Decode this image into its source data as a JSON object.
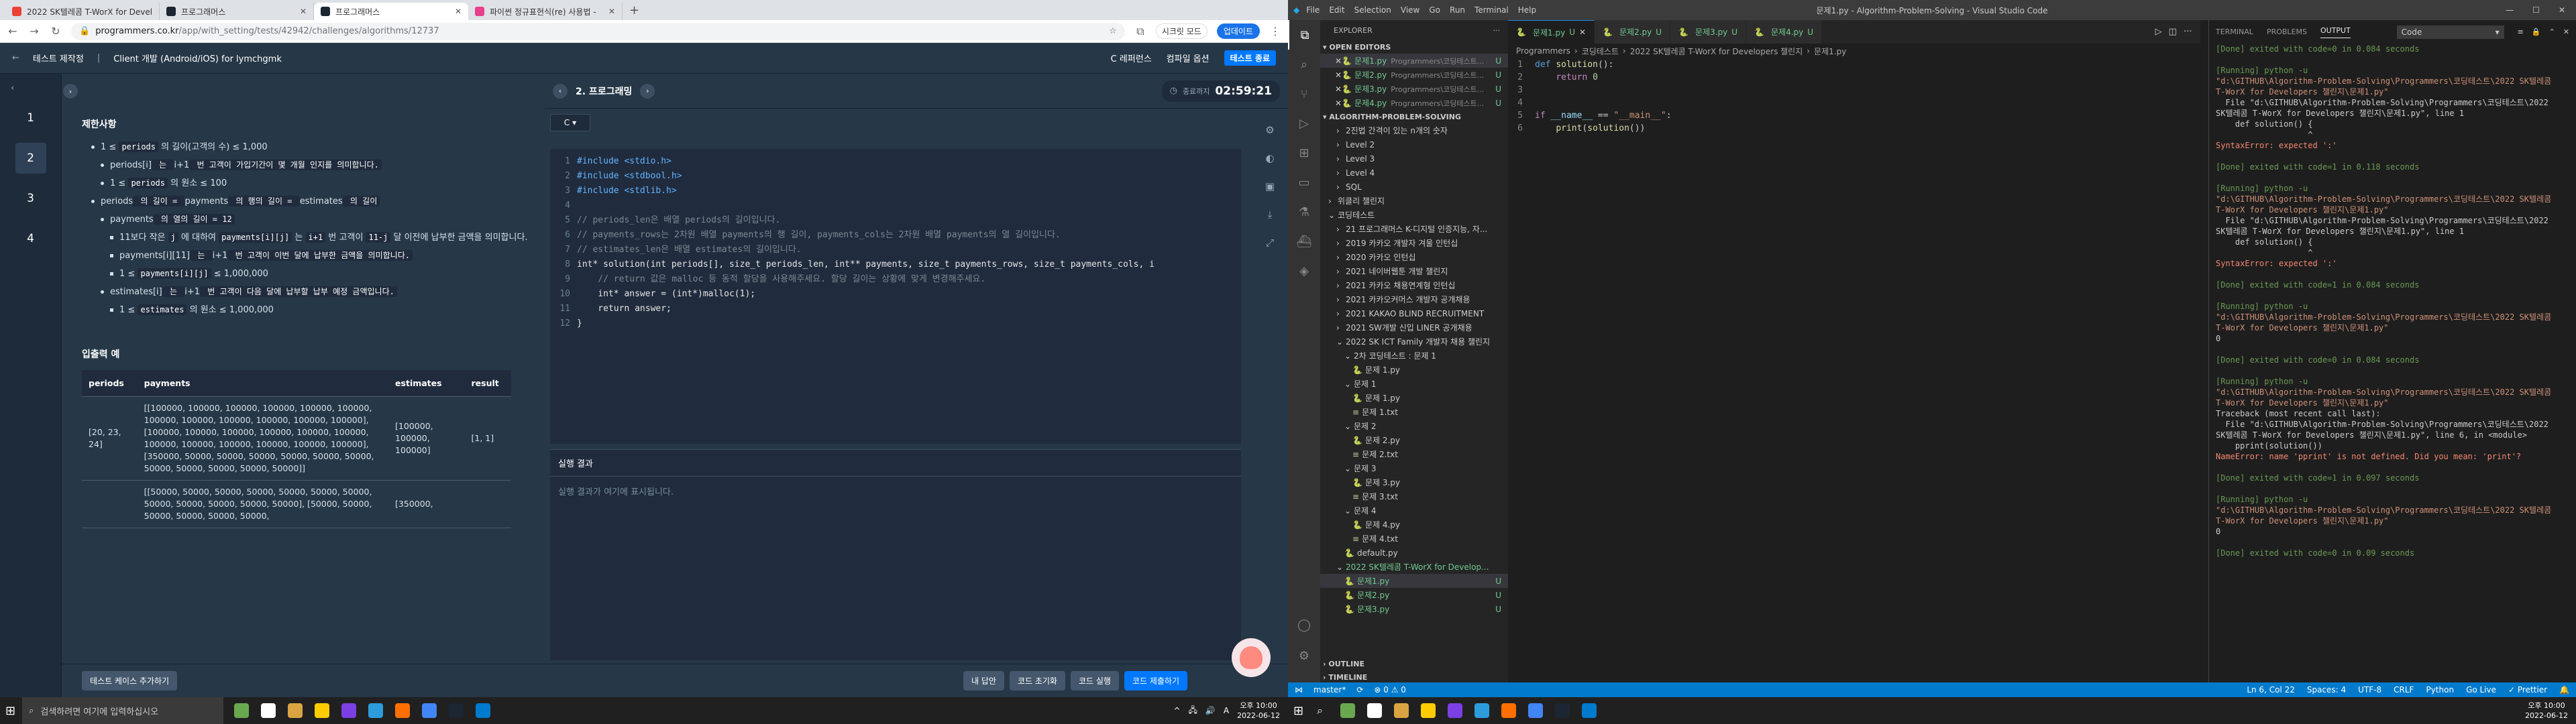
{
  "chrome": {
    "tabs": [
      {
        "label": "2022 SK텔레콤 T-WorX for Devel",
        "color": "#ea4335"
      },
      {
        "label": "프로그래머스",
        "color": "#1c2633"
      },
      {
        "label": "프로그래머스",
        "color": "#1c2633"
      },
      {
        "label": "파이썬 정규표현식(re) 사용법 -",
        "color": "#e83e8c"
      }
    ],
    "url_host": "programmers.co.kr",
    "url_path": "/app/with_setting/tests/42942/challenges/algorithms/12737",
    "secret_mode": "시크릿 모드",
    "update_label": "업데이트"
  },
  "pg": {
    "breadcrumb_test": "테스트 제작정",
    "breadcrumb_course": "Client 개발 (Android/iOS) for lymchgmk",
    "header_links": [
      "C 레퍼런스",
      "컴파일 옵션"
    ],
    "test_end": "테스트 종료",
    "questions": [
      "1",
      "2",
      "3",
      "4"
    ],
    "problem_title": "2. 프로그래밍",
    "timer_label": "종료까지",
    "timer_value": "02:59:21",
    "lang": "C",
    "section_constraints": "제한사항",
    "constraints": [
      {
        "level": 1,
        "parts": [
          "1 ≤ ",
          "periods",
          " 의 길이(고객의 수) ≤ 1,000"
        ]
      },
      {
        "level": 2,
        "parts": [
          "periods[i]",
          " 는 ",
          "i+1",
          " 번 고객이 가입기간이 몇 개월 인지를 의미합니다."
        ]
      },
      {
        "level": 2,
        "parts": [
          "1 ≤ ",
          "periods",
          " 의 원소 ≤ 100"
        ]
      },
      {
        "level": 1,
        "parts": [
          "periods",
          " 의 길이 = ",
          "payments",
          " 의 행의 길이 = ",
          "estimates",
          " 의 길이"
        ]
      },
      {
        "level": 2,
        "parts": [
          "payments",
          " 의 열의 길이 = 12"
        ]
      },
      {
        "level": 3,
        "parts": [
          "11보다 작은 ",
          "j",
          " 에 대하여 ",
          "payments[i][j]",
          " 는 ",
          "i+1",
          " 번 고객이 ",
          "11-j",
          " 달 이전에 납부한 금액을 의미합니다."
        ]
      },
      {
        "level": 3,
        "parts": [
          "payments[i][11]",
          " 는 ",
          "i+1",
          " 번 고객이 이번 달에 납부한 금액을 의미합니다."
        ]
      },
      {
        "level": 3,
        "parts": [
          "1 ≤ ",
          "payments[i][j]",
          " ≤ 1,000,000"
        ]
      },
      {
        "level": 2,
        "parts": [
          "estimates[i]",
          " 는 ",
          "i+1",
          " 번 고객이 다음 달에 납부할 납부 예정 금액입니다."
        ]
      },
      {
        "level": 3,
        "parts": [
          "1 ≤ ",
          "estimates",
          " 의 원소 ≤ 1,000,000"
        ]
      }
    ],
    "section_example": "입출력 예",
    "example_headers": [
      "periods",
      "payments",
      "estimates",
      "result"
    ],
    "example_rows": [
      [
        "[20, 23, 24]",
        "[[100000, 100000, 100000, 100000, 100000, 100000, 100000, 100000, 100000, 100000, 100000, 100000], [100000, 100000, 100000, 100000, 100000, 100000, 100000, 100000, 100000, 100000, 100000, 100000], [350000, 50000, 50000, 50000, 50000, 50000, 50000, 50000, 50000, 50000, 50000, 50000]]",
        "[100000, 100000, 100000]",
        "[1, 1]"
      ],
      [
        "",
        "[[50000, 50000, 50000, 50000, 50000, 50000, 50000, 50000, 50000, 50000, 50000, 50000], [50000, 50000, 50000, 50000, 50000, 50000,",
        "[350000,",
        ""
      ]
    ],
    "code_lines": [
      "#include <stdio.h>",
      "#include <stdbool.h>",
      "#include <stdlib.h>",
      "",
      "// periods_len은 배열 periods의 길이입니다.",
      "// payments_rows는 2차원 배열 payments의 행 길이, payments_cols는 2차원 배열 payments의 열 길이입니다.",
      "// estimates_len은 배열 estimates의 길이입니다.",
      "int* solution(int periods[], size_t periods_len, int** payments, size_t payments_rows, size_t payments_cols, i",
      "    // return 값은 malloc 등 동적 할당을 사용해주세요. 할당 길이는 상황에 맞게 변경해주세요.",
      "    int* answer = (int*)malloc(1);",
      "    return answer;",
      "}"
    ],
    "result_title": "실행 결과",
    "result_placeholder": "실행 결과가 여기에 표시됩니다.",
    "add_test": "테스트 케이스 추가하기",
    "btn_question": "내 답안",
    "btn_reset": "코드 초기화",
    "btn_run": "코드 실행",
    "btn_submit": "코드 제출하기"
  },
  "taskbar_left": {
    "search_placeholder": "검색하려면 여기에 입력하십시오",
    "time": "오후 10:00",
    "date": "2022-06-12",
    "icon_colors": [
      "#6aa84f",
      "#fff",
      "#d9a441",
      "#ffcc00",
      "#7b3fe4",
      "#2d9cdb",
      "#ff6f00",
      "#4285f4",
      "#1c2633",
      "#007acc"
    ]
  },
  "vscode": {
    "menu": [
      "File",
      "Edit",
      "Selection",
      "View",
      "Go",
      "Run",
      "Terminal",
      "Help"
    ],
    "window_title": "문제1.py - Algorithm-Problem-Solving - Visual Studio Code",
    "explorer_title": "EXPLORER",
    "open_editors": "OPEN EDITORS",
    "open_files": [
      {
        "name": "문제1.py",
        "path": "Programmers\\코딩테스트...",
        "status": "U"
      },
      {
        "name": "문제2.py",
        "path": "Programmers\\코딩테스트...",
        "status": "U"
      },
      {
        "name": "문제3.py",
        "path": "Programmers\\코딩테스트...",
        "status": "U"
      },
      {
        "name": "문제4.py",
        "path": "Programmers\\코딩테스트...",
        "status": "U"
      }
    ],
    "project": "ALGORITHM-PROBLEM-SOLVING",
    "tree": [
      {
        "indent": 1,
        "label": "2진법 간격이 있는 n개의 숫자",
        "kind": "folder"
      },
      {
        "indent": 1,
        "label": "Level 2",
        "kind": "folder"
      },
      {
        "indent": 1,
        "label": "Level 3",
        "kind": "folder"
      },
      {
        "indent": 1,
        "label": "Level 4",
        "kind": "folder"
      },
      {
        "indent": 1,
        "label": "SQL",
        "kind": "folder"
      },
      {
        "indent": 0,
        "label": "위클리 챌린지",
        "kind": "folder"
      },
      {
        "indent": 0,
        "label": "코딩테스트",
        "kind": "folder-open"
      },
      {
        "indent": 1,
        "label": "21 프로그래머스 K-디지털 인증지능, 자...",
        "kind": "folder"
      },
      {
        "indent": 1,
        "label": "2019 카카오 개발자 겨울 인턴십",
        "kind": "folder"
      },
      {
        "indent": 1,
        "label": "2020 카카오 인턴십",
        "kind": "folder"
      },
      {
        "indent": 1,
        "label": "2021 네이버웹툰 개발 챌린지",
        "kind": "folder"
      },
      {
        "indent": 1,
        "label": "2021 카카오 채용연계형 인턴십",
        "kind": "folder"
      },
      {
        "indent": 1,
        "label": "2021 카카오커머스 개발자 공개채용",
        "kind": "folder"
      },
      {
        "indent": 1,
        "label": "2021 KAKAO BLIND RECRUITMENT",
        "kind": "folder"
      },
      {
        "indent": 1,
        "label": "2021 SW개발 신입 LINER 공개채용",
        "kind": "folder"
      },
      {
        "indent": 1,
        "label": "2022 SK ICT Family 개발자 채용 챌린지",
        "kind": "folder-open"
      },
      {
        "indent": 2,
        "label": "2차 코딩테스트 : 문제 1",
        "kind": "folder-open"
      },
      {
        "indent": 3,
        "label": "문제 1.py",
        "kind": "py"
      },
      {
        "indent": 2,
        "label": "문제 1",
        "kind": "folder-open"
      },
      {
        "indent": 3,
        "label": "문제 1.py",
        "kind": "py"
      },
      {
        "indent": 3,
        "label": "문제 1.txt",
        "kind": "txt"
      },
      {
        "indent": 2,
        "label": "문제 2",
        "kind": "folder-open"
      },
      {
        "indent": 3,
        "label": "문제 2.py",
        "kind": "py"
      },
      {
        "indent": 3,
        "label": "문제 2.txt",
        "kind": "txt"
      },
      {
        "indent": 2,
        "label": "문제 3",
        "kind": "folder-open"
      },
      {
        "indent": 3,
        "label": "문제 3.py",
        "kind": "py"
      },
      {
        "indent": 3,
        "label": "문제 3.txt",
        "kind": "txt"
      },
      {
        "indent": 2,
        "label": "문제 4",
        "kind": "folder-open"
      },
      {
        "indent": 3,
        "label": "문제 4.py",
        "kind": "py"
      },
      {
        "indent": 3,
        "label": "문제 4.txt",
        "kind": "txt"
      },
      {
        "indent": 2,
        "label": "default.py",
        "kind": "py"
      },
      {
        "indent": 1,
        "label": "2022 SK텔레콤 T-WorX for Develop...",
        "kind": "folder-open-green"
      },
      {
        "indent": 2,
        "label": "문제1.py",
        "kind": "py-sel",
        "status": "U"
      },
      {
        "indent": 2,
        "label": "문제2.py",
        "kind": "py-green",
        "status": "U"
      },
      {
        "indent": 2,
        "label": "문제3.py",
        "kind": "py-green",
        "status": "U"
      }
    ],
    "outline": "OUTLINE",
    "timeline": "TIMELINE",
    "editor_tabs": [
      {
        "label": "문제1.py",
        "status": "U"
      },
      {
        "label": "문제2.py",
        "status": "U"
      },
      {
        "label": "문제3.py",
        "status": "U"
      },
      {
        "label": "문제4.py",
        "status": "U"
      }
    ],
    "breadcrumbs": [
      "Programmers",
      "코딩테스트",
      "2022 SK텔레콤 T-WorX for Developers 챌린지",
      "문제1.py"
    ],
    "panel_tabs": [
      "TERMINAL",
      "PROBLEMS",
      "OUTPUT"
    ],
    "panel_select": "Code",
    "output_lines": [
      {
        "t": "done",
        "s": "[Done] exited with code=0 in 0.084 seconds"
      },
      {
        "t": "",
        "s": ""
      },
      {
        "t": "run",
        "s": "[Running] python -u"
      },
      {
        "t": "path",
        "s": "\"d:\\GITHUB\\Algorithm-Problem-Solving\\Programmers\\코딩테스트\\2022 SK텔레콤"
      },
      {
        "t": "path",
        "s": "T-WorX for Developers 챌린지\\문제1.py\""
      },
      {
        "t": "",
        "s": "  File \"d:\\GITHUB\\Algorithm-Problem-Solving\\Programmers\\코딩테스트\\2022"
      },
      {
        "t": "",
        "s": "SK텔레콤 T-WorX for Developers 챌린지\\문제1.py\", line 1"
      },
      {
        "t": "",
        "s": "    def solution() {"
      },
      {
        "t": "",
        "s": "                   ^"
      },
      {
        "t": "err",
        "s": "SyntaxError: expected ':'"
      },
      {
        "t": "",
        "s": ""
      },
      {
        "t": "done",
        "s": "[Done] exited with code=1 in 0.118 seconds"
      },
      {
        "t": "",
        "s": ""
      },
      {
        "t": "run",
        "s": "[Running] python -u"
      },
      {
        "t": "path",
        "s": "\"d:\\GITHUB\\Algorithm-Problem-Solving\\Programmers\\코딩테스트\\2022 SK텔레콤"
      },
      {
        "t": "path",
        "s": "T-WorX for Developers 챌린지\\문제1.py\""
      },
      {
        "t": "",
        "s": "  File \"d:\\GITHUB\\Algorithm-Problem-Solving\\Programmers\\코딩테스트\\2022"
      },
      {
        "t": "",
        "s": "SK텔레콤 T-WorX for Developers 챌린지\\문제1.py\", line 1"
      },
      {
        "t": "",
        "s": "    def solution() {"
      },
      {
        "t": "",
        "s": "                   ^"
      },
      {
        "t": "err",
        "s": "SyntaxError: expected ':'"
      },
      {
        "t": "",
        "s": ""
      },
      {
        "t": "done",
        "s": "[Done] exited with code=1 in 0.084 seconds"
      },
      {
        "t": "",
        "s": ""
      },
      {
        "t": "run",
        "s": "[Running] python -u"
      },
      {
        "t": "path",
        "s": "\"d:\\GITHUB\\Algorithm-Problem-Solving\\Programmers\\코딩테스트\\2022 SK텔레콤"
      },
      {
        "t": "path",
        "s": "T-WorX for Developers 챌린지\\문제1.py\""
      },
      {
        "t": "",
        "s": "0"
      },
      {
        "t": "",
        "s": ""
      },
      {
        "t": "done",
        "s": "[Done] exited with code=0 in 0.084 seconds"
      },
      {
        "t": "",
        "s": ""
      },
      {
        "t": "run",
        "s": "[Running] python -u"
      },
      {
        "t": "path",
        "s": "\"d:\\GITHUB\\Algorithm-Problem-Solving\\Programmers\\코딩테스트\\2022 SK텔레콤"
      },
      {
        "t": "path",
        "s": "T-WorX for Developers 챌린지\\문제1.py\""
      },
      {
        "t": "",
        "s": "Traceback (most recent call last):"
      },
      {
        "t": "",
        "s": "  File \"d:\\GITHUB\\Algorithm-Problem-Solving\\Programmers\\코딩테스트\\2022"
      },
      {
        "t": "",
        "s": "SK텔레콤 T-WorX for Developers 챌린지\\문제1.py\", line 6, in <module>"
      },
      {
        "t": "",
        "s": "    pprint(solution())"
      },
      {
        "t": "err",
        "s": "NameError: name 'pprint' is not defined. Did you mean: 'print'?"
      },
      {
        "t": "",
        "s": ""
      },
      {
        "t": "done",
        "s": "[Done] exited with code=1 in 0.097 seconds"
      },
      {
        "t": "",
        "s": ""
      },
      {
        "t": "run",
        "s": "[Running] python -u"
      },
      {
        "t": "path",
        "s": "\"d:\\GITHUB\\Algorithm-Problem-Solving\\Programmers\\코딩테스트\\2022 SK텔레콤"
      },
      {
        "t": "path",
        "s": "T-WorX for Developers 챌린지\\문제1.py\""
      },
      {
        "t": "",
        "s": "0"
      },
      {
        "t": "",
        "s": ""
      },
      {
        "t": "done",
        "s": "[Done] exited with code=0 in 0.09 seconds"
      }
    ],
    "status": {
      "branch": "master*",
      "sync": "⟳",
      "problems": "⊗ 0 ⚠ 0",
      "position": "Ln 6, Col 22",
      "spaces": "Spaces: 4",
      "encoding": "UTF-8",
      "eol": "CRLF",
      "language": "Python",
      "golive": "Go Live",
      "prettier": "✓ Prettier"
    }
  },
  "taskbar_right": {
    "time": "오후 10:00",
    "date": "2022-06-12"
  }
}
